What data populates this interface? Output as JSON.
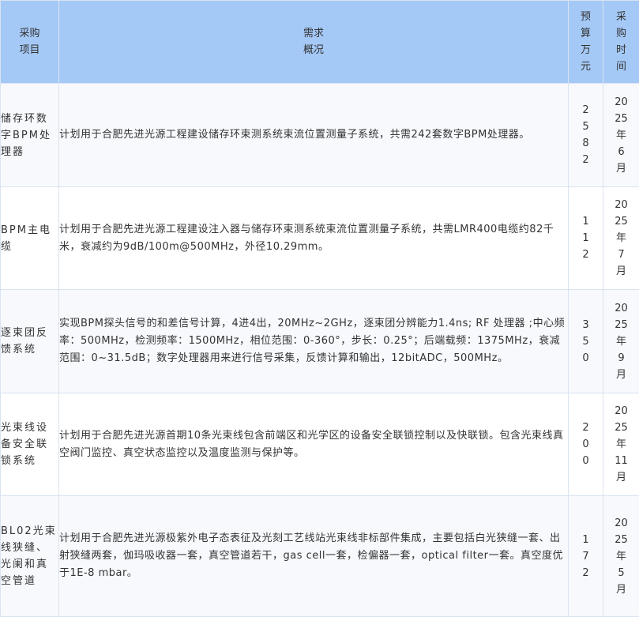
{
  "header": {
    "item": [
      "采购",
      "项目"
    ],
    "desc": [
      "需求",
      "概况"
    ],
    "budget": [
      "预",
      "算",
      "万",
      "元"
    ],
    "time": [
      "采",
      "购",
      "时",
      "间"
    ]
  },
  "rows": [
    {
      "item": "储存环数字BPM处理器",
      "desc": "计划用于合肥先进光源工程建设储存环束测系统束流位置测量子系统，共需242套数字BPM处理器。",
      "budget": [
        "2",
        "5",
        "8",
        "2"
      ],
      "time": [
        "20",
        "25",
        "年",
        "6",
        "月"
      ]
    },
    {
      "item": "BPM主电缆",
      "desc": "计划用于合肥先进光源工程建设注入器与储存环束测系统束流位置测量子系统，共需LMR400电缆约82千米，衰减约为9dB/100m@500MHz，外径10.29mm。",
      "budget": [
        "1",
        "1",
        "2"
      ],
      "time": [
        "20",
        "25",
        "年",
        "7",
        "月"
      ]
    },
    {
      "item": "逐束团反馈系统",
      "desc": "实现BPM探头信号的和差信号计算，4进4出，20MHz~2GHz，逐束团分辨能力1.4ns; RF 处理器 ;中心频率：500MHz，检测频率：1500MHz，相位范围：0-360°，步长：0.25°；后端载频：1375MHz，衰减范围：0~31.5dB；数字处理器用来进行信号采集，反馈计算和输出，12bitADC，500MHz。",
      "budget": [
        "3",
        "5",
        "0"
      ],
      "time": [
        "20",
        "25",
        "年",
        "9",
        "月"
      ]
    },
    {
      "item": "光束线设备安全联锁系统",
      "desc": "计划用于合肥先进光源首期10条光束线包含前端区和光学区的设备安全联锁控制以及快联锁。包含光束线真空阀门监控、真空状态监控以及温度监测与保护等。",
      "budget": [
        "2",
        "0",
        "0"
      ],
      "time": [
        "20",
        "25",
        "年",
        "11",
        "月"
      ]
    },
    {
      "item": "BL02光束线狭缝、光阑和真空管道",
      "desc": "计划用于合肥先进光源极紫外电子态表征及光刻工艺线站光束线非标部件集成，主要包括白光狭缝一套、出射狭缝两套，伽玛吸收器一套，真空管道若干，gas cell一套，检偏器一套，optical filter一套。真空度优于1E-8 mbar。",
      "budget": [
        "1",
        "7",
        "2"
      ],
      "time": [
        "20",
        "25",
        "年",
        "5",
        "月"
      ]
    }
  ]
}
